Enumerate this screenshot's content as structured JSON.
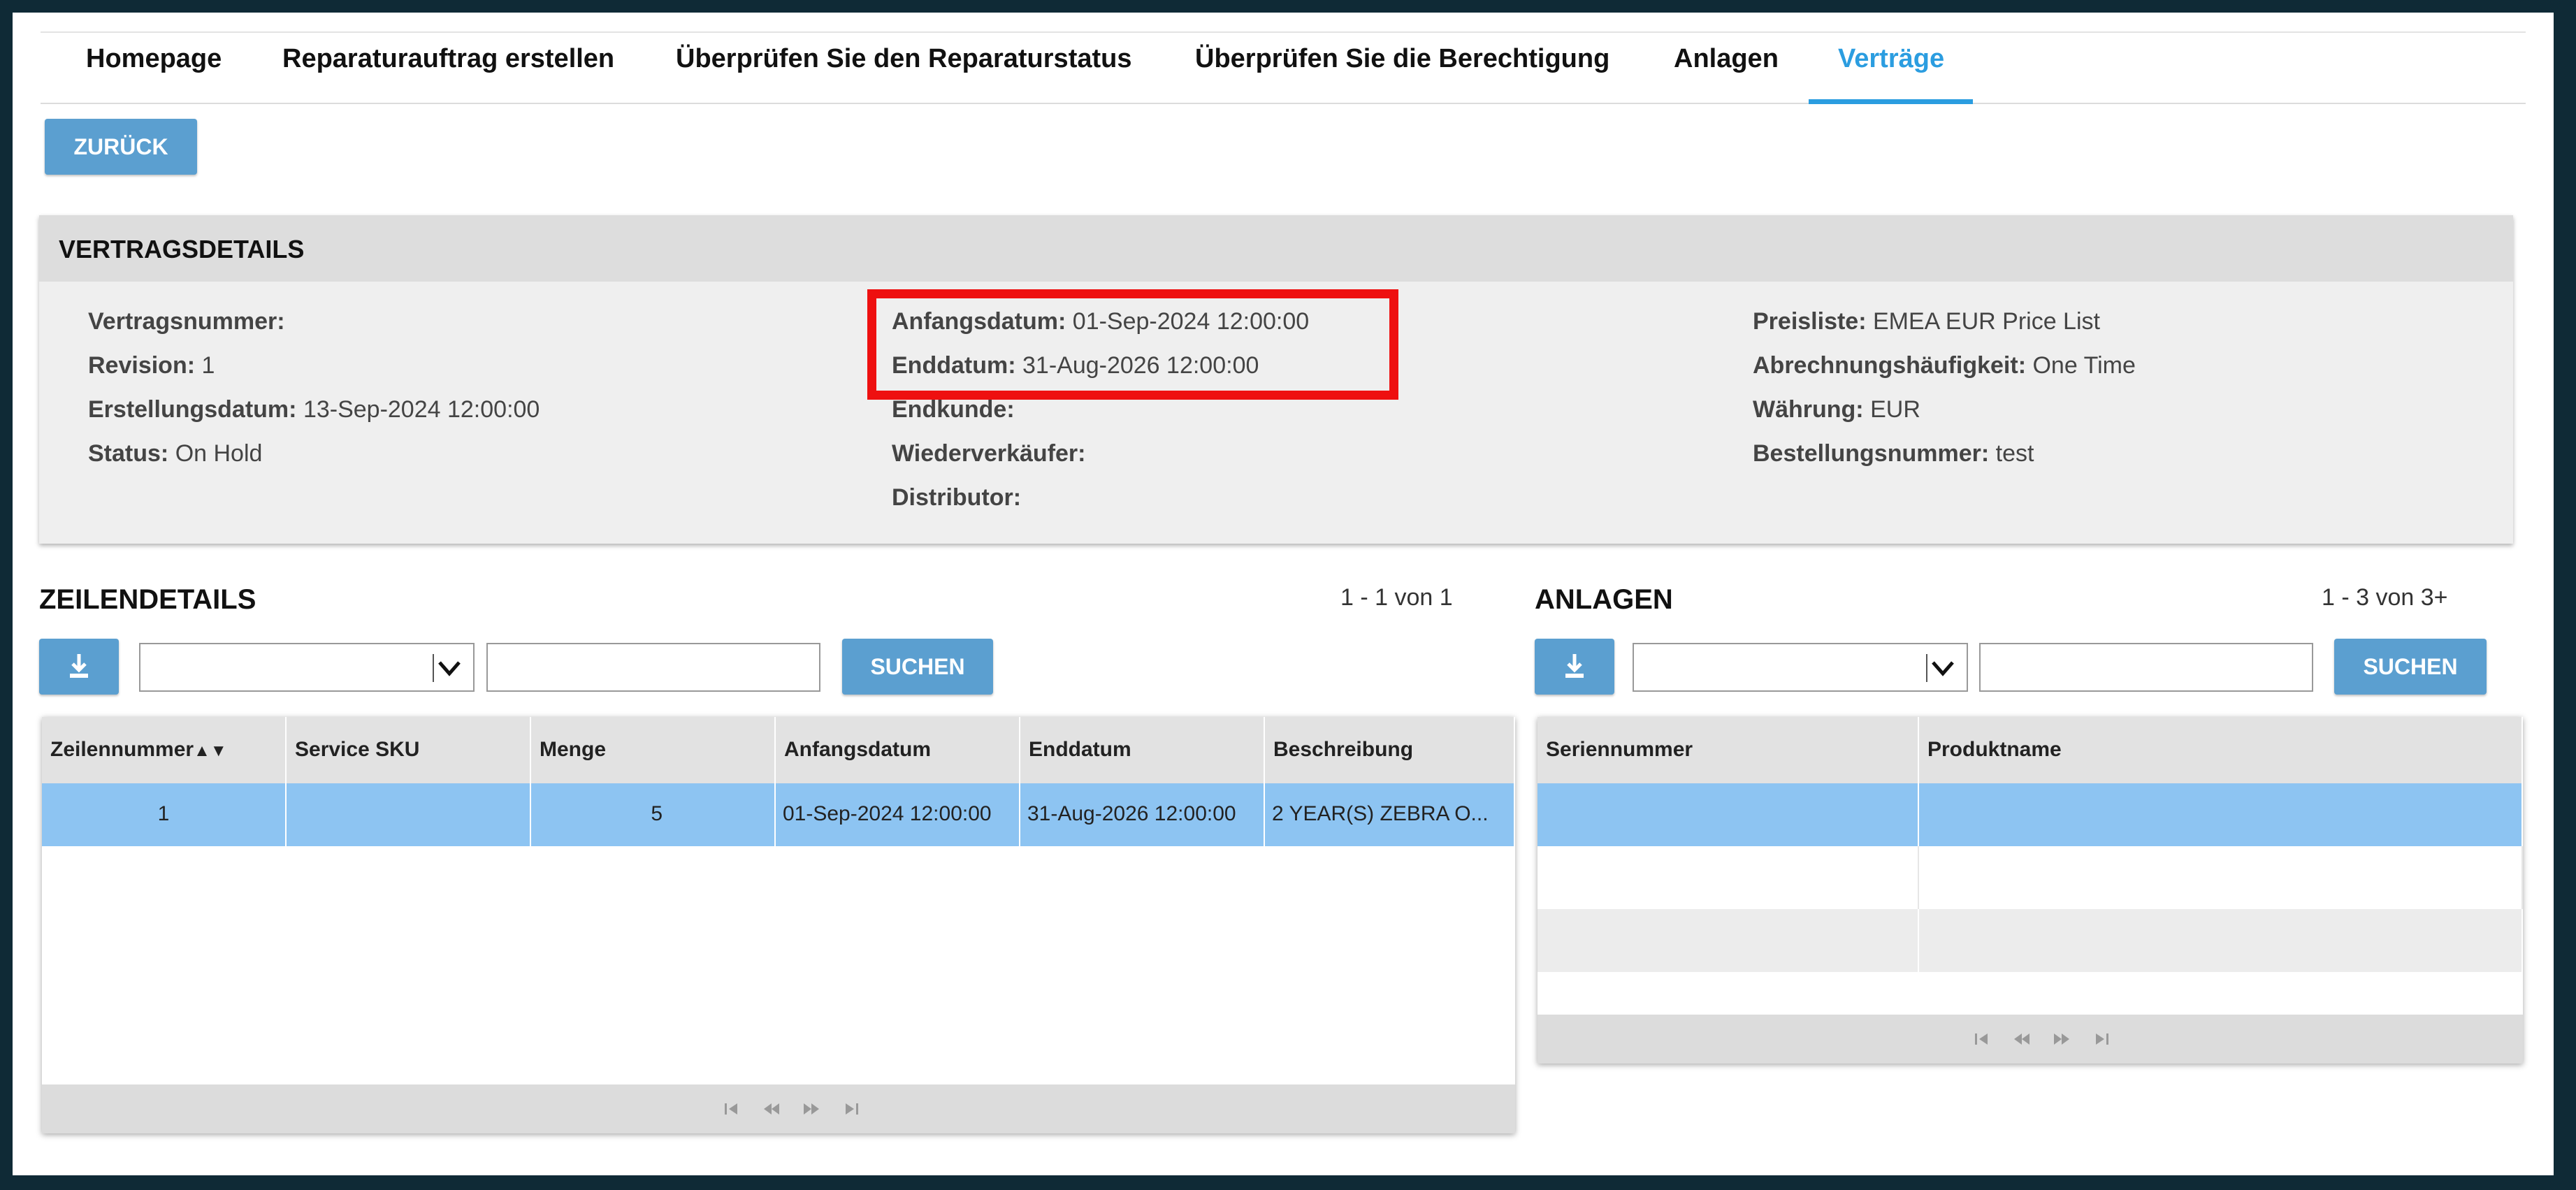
{
  "nav": {
    "items": [
      {
        "label": "Homepage"
      },
      {
        "label": "Reparaturauftrag erstellen"
      },
      {
        "label": "Überprüfen Sie den Reparaturstatus"
      },
      {
        "label": "Überprüfen Sie die Berechtigung"
      },
      {
        "label": "Anlagen"
      },
      {
        "label": "Verträge"
      }
    ],
    "active": "Verträge"
  },
  "back_button": "ZURÜCK",
  "details": {
    "title": "VERTRAGSDETAILS",
    "col1": [
      {
        "label": "Vertragsnummer:",
        "value": ""
      },
      {
        "label": "Revision:",
        "value": "1"
      },
      {
        "label": "Erstellungsdatum:",
        "value": "13-Sep-2024 12:00:00"
      },
      {
        "label": "Status:",
        "value": "On Hold"
      }
    ],
    "col2": [
      {
        "label": "Anfangsdatum:",
        "value": "01-Sep-2024 12:00:00"
      },
      {
        "label": "Enddatum:",
        "value": "31-Aug-2026 12:00:00"
      },
      {
        "label": "Endkunde:",
        "value": ""
      },
      {
        "label": "Wiederverkäufer:",
        "value": ""
      },
      {
        "label": "Distributor:",
        "value": ""
      }
    ],
    "col3": [
      {
        "label": "Preisliste:",
        "value": "EMEA EUR Price List"
      },
      {
        "label": "Abrechnungshäufigkeit:",
        "value": "One Time"
      },
      {
        "label": "Währung:",
        "value": "EUR"
      },
      {
        "label": "Bestellungsnummer:",
        "value": "test"
      }
    ],
    "highlight_color": "#ee1010"
  },
  "line_details": {
    "title": "ZEILENDETAILS",
    "count": "1 - 1 von 1",
    "search_label": "SUCHEN",
    "download_icon": "download-icon",
    "columns": [
      "Zeilennummer",
      "Service SKU",
      "Menge",
      "Anfangsdatum",
      "Enddatum",
      "Beschreibung"
    ],
    "rows": [
      {
        "zeilennummer": "1",
        "sku": "",
        "menge": "5",
        "anfangsdatum": "01-Sep-2024 12:00:00",
        "enddatum": "31-Aug-2026 12:00:00",
        "beschreibung": "2 YEAR(S) ZEBRA O..."
      }
    ]
  },
  "assets": {
    "title": "ANLAGEN",
    "count": "1 - 3 von 3+",
    "search_label": "SUCHEN",
    "download_icon": "download-icon",
    "columns": [
      "Seriennummer",
      "Produktname"
    ]
  },
  "colors": {
    "accent": "#2b9de0",
    "button": "#5b9fd0",
    "selected_row": "#8dc4f2"
  }
}
